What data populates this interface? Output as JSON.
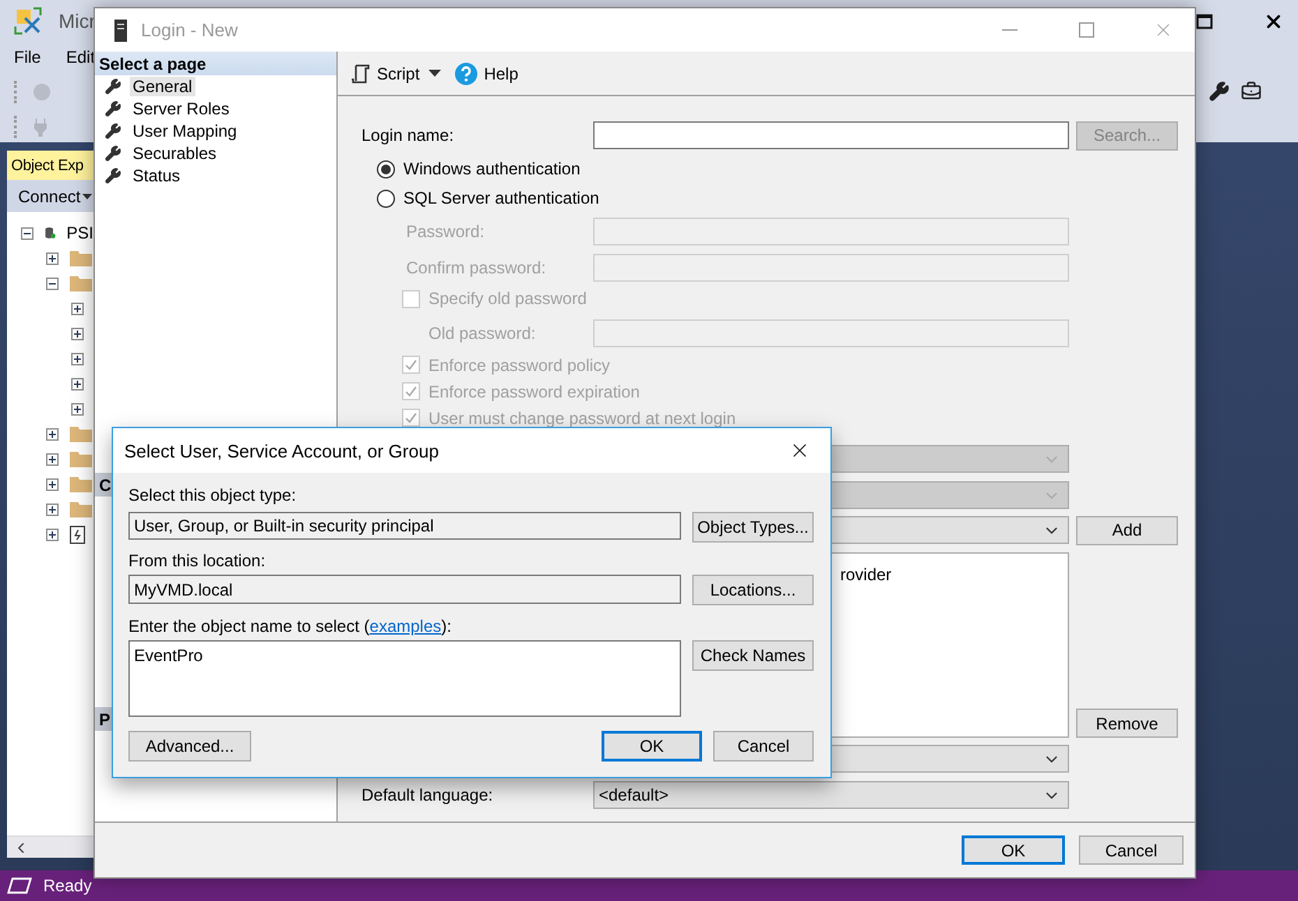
{
  "app": {
    "title": "Micr",
    "menu": [
      "File",
      "Edit"
    ],
    "object_explorer": {
      "title": "Object Exp",
      "connect": "Connect",
      "tree": [
        {
          "label": "PSI",
          "kind": "server",
          "expanded": true,
          "children": [
            {
              "kind": "folder",
              "expanded": false
            },
            {
              "kind": "folder",
              "expanded": true,
              "children": [
                {
                  "expanded": false
                },
                {
                  "expanded": false
                },
                {
                  "expanded": false
                },
                {
                  "expanded": false
                },
                {
                  "expanded": false
                }
              ]
            },
            {
              "kind": "folder",
              "expanded": false
            },
            {
              "kind": "folder",
              "expanded": false
            },
            {
              "kind": "folder",
              "expanded": false
            },
            {
              "kind": "folder",
              "expanded": false
            },
            {
              "kind": "log",
              "expanded": false
            }
          ]
        }
      ]
    },
    "status": "Ready"
  },
  "login_dialog": {
    "title": "Login - New",
    "pages_header": "Select a page",
    "pages": [
      {
        "label": "General",
        "selected": true
      },
      {
        "label": "Server Roles",
        "selected": false
      },
      {
        "label": "User Mapping",
        "selected": false
      },
      {
        "label": "Securables",
        "selected": false
      },
      {
        "label": "Status",
        "selected": false
      }
    ],
    "sections": [
      "C",
      "P"
    ],
    "toolbar": {
      "script": "Script",
      "help": "Help"
    },
    "form": {
      "login_name": {
        "label": "Login name:",
        "search_button": {
          "label": "Search...",
          "disabled": true
        }
      },
      "authentication": [
        {
          "label": "Windows authentication",
          "selected": true
        },
        {
          "label": "SQL Server authentication",
          "selected": false
        }
      ],
      "password_fields": [
        {
          "label": "Password:",
          "disabled": true
        },
        {
          "label": "Confirm password:",
          "disabled": true
        }
      ],
      "specify_old_password": {
        "label": "Specify old password",
        "checked": false,
        "disabled": true
      },
      "old_password": {
        "label": "Old password:",
        "disabled": true
      },
      "policy_options": [
        {
          "label": "Enforce password policy",
          "checked": true,
          "disabled": true
        },
        {
          "label": "Enforce password expiration",
          "checked": true,
          "disabled": true
        },
        {
          "label": "User must change password at next login",
          "checked": true,
          "disabled": true
        }
      ],
      "mapped_dropdowns": [
        {
          "disabled": true
        },
        {
          "disabled": true
        }
      ],
      "credential_dropdown": {
        "disabled": false
      },
      "add_button": "Add",
      "credentials_list": [
        "rovider"
      ],
      "remove_button": "Remove",
      "default_database_dropdown": {
        "disabled": false
      },
      "default_language": {
        "label": "Default language:",
        "value": "<default>"
      }
    },
    "ok": "OK",
    "cancel": "Cancel"
  },
  "select_dialog": {
    "title": "Select User, Service Account, or Group",
    "object_type_label": "Select this object type:",
    "object_type": "User, Group, or Built-in security principal",
    "object_types_button": "Object Types...",
    "location_label": "From this location:",
    "location": "MyVMD.local",
    "locations_button": "Locations...",
    "name_label_before": "Enter the object name to select (",
    "name_label_link": "examples",
    "name_label_after": "):",
    "name_value": "EventPro",
    "check_names_button": "Check Names",
    "advanced_button": "Advanced...",
    "ok": "OK",
    "cancel": "Cancel"
  }
}
